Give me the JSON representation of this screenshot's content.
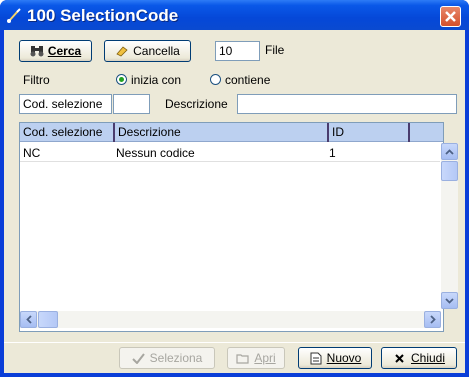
{
  "window": {
    "title": "100 SelectionCode",
    "icons": {
      "app": "brush-icon",
      "close": "close-x-icon"
    }
  },
  "toolbar": {
    "search_label": "Cerca",
    "clear_label": "Cancella",
    "rows_value": "10",
    "rows_label": "File"
  },
  "filter": {
    "label": "Filtro",
    "option_starts": "inizia con",
    "option_contains": "contiene",
    "selected": "inizia con"
  },
  "fields": {
    "code_label": "Cod. selezione",
    "code_value": "",
    "desc_label": "Descrizione",
    "desc_value": ""
  },
  "grid": {
    "columns": [
      "Cod. selezione",
      "Descrizione",
      "ID",
      ""
    ],
    "rows": [
      {
        "code": "NC",
        "description": "Nessun codice",
        "id": "1"
      }
    ]
  },
  "footer": {
    "select_label": "Seleziona",
    "open_label": "Apri",
    "new_label": "Nuovo",
    "close_label": "Chiudi"
  },
  "colors": {
    "titlebar": "#0548d8",
    "client_bg": "#ece9d8",
    "grid_header": "#bcd0f0",
    "close_button": "#d4502c"
  }
}
